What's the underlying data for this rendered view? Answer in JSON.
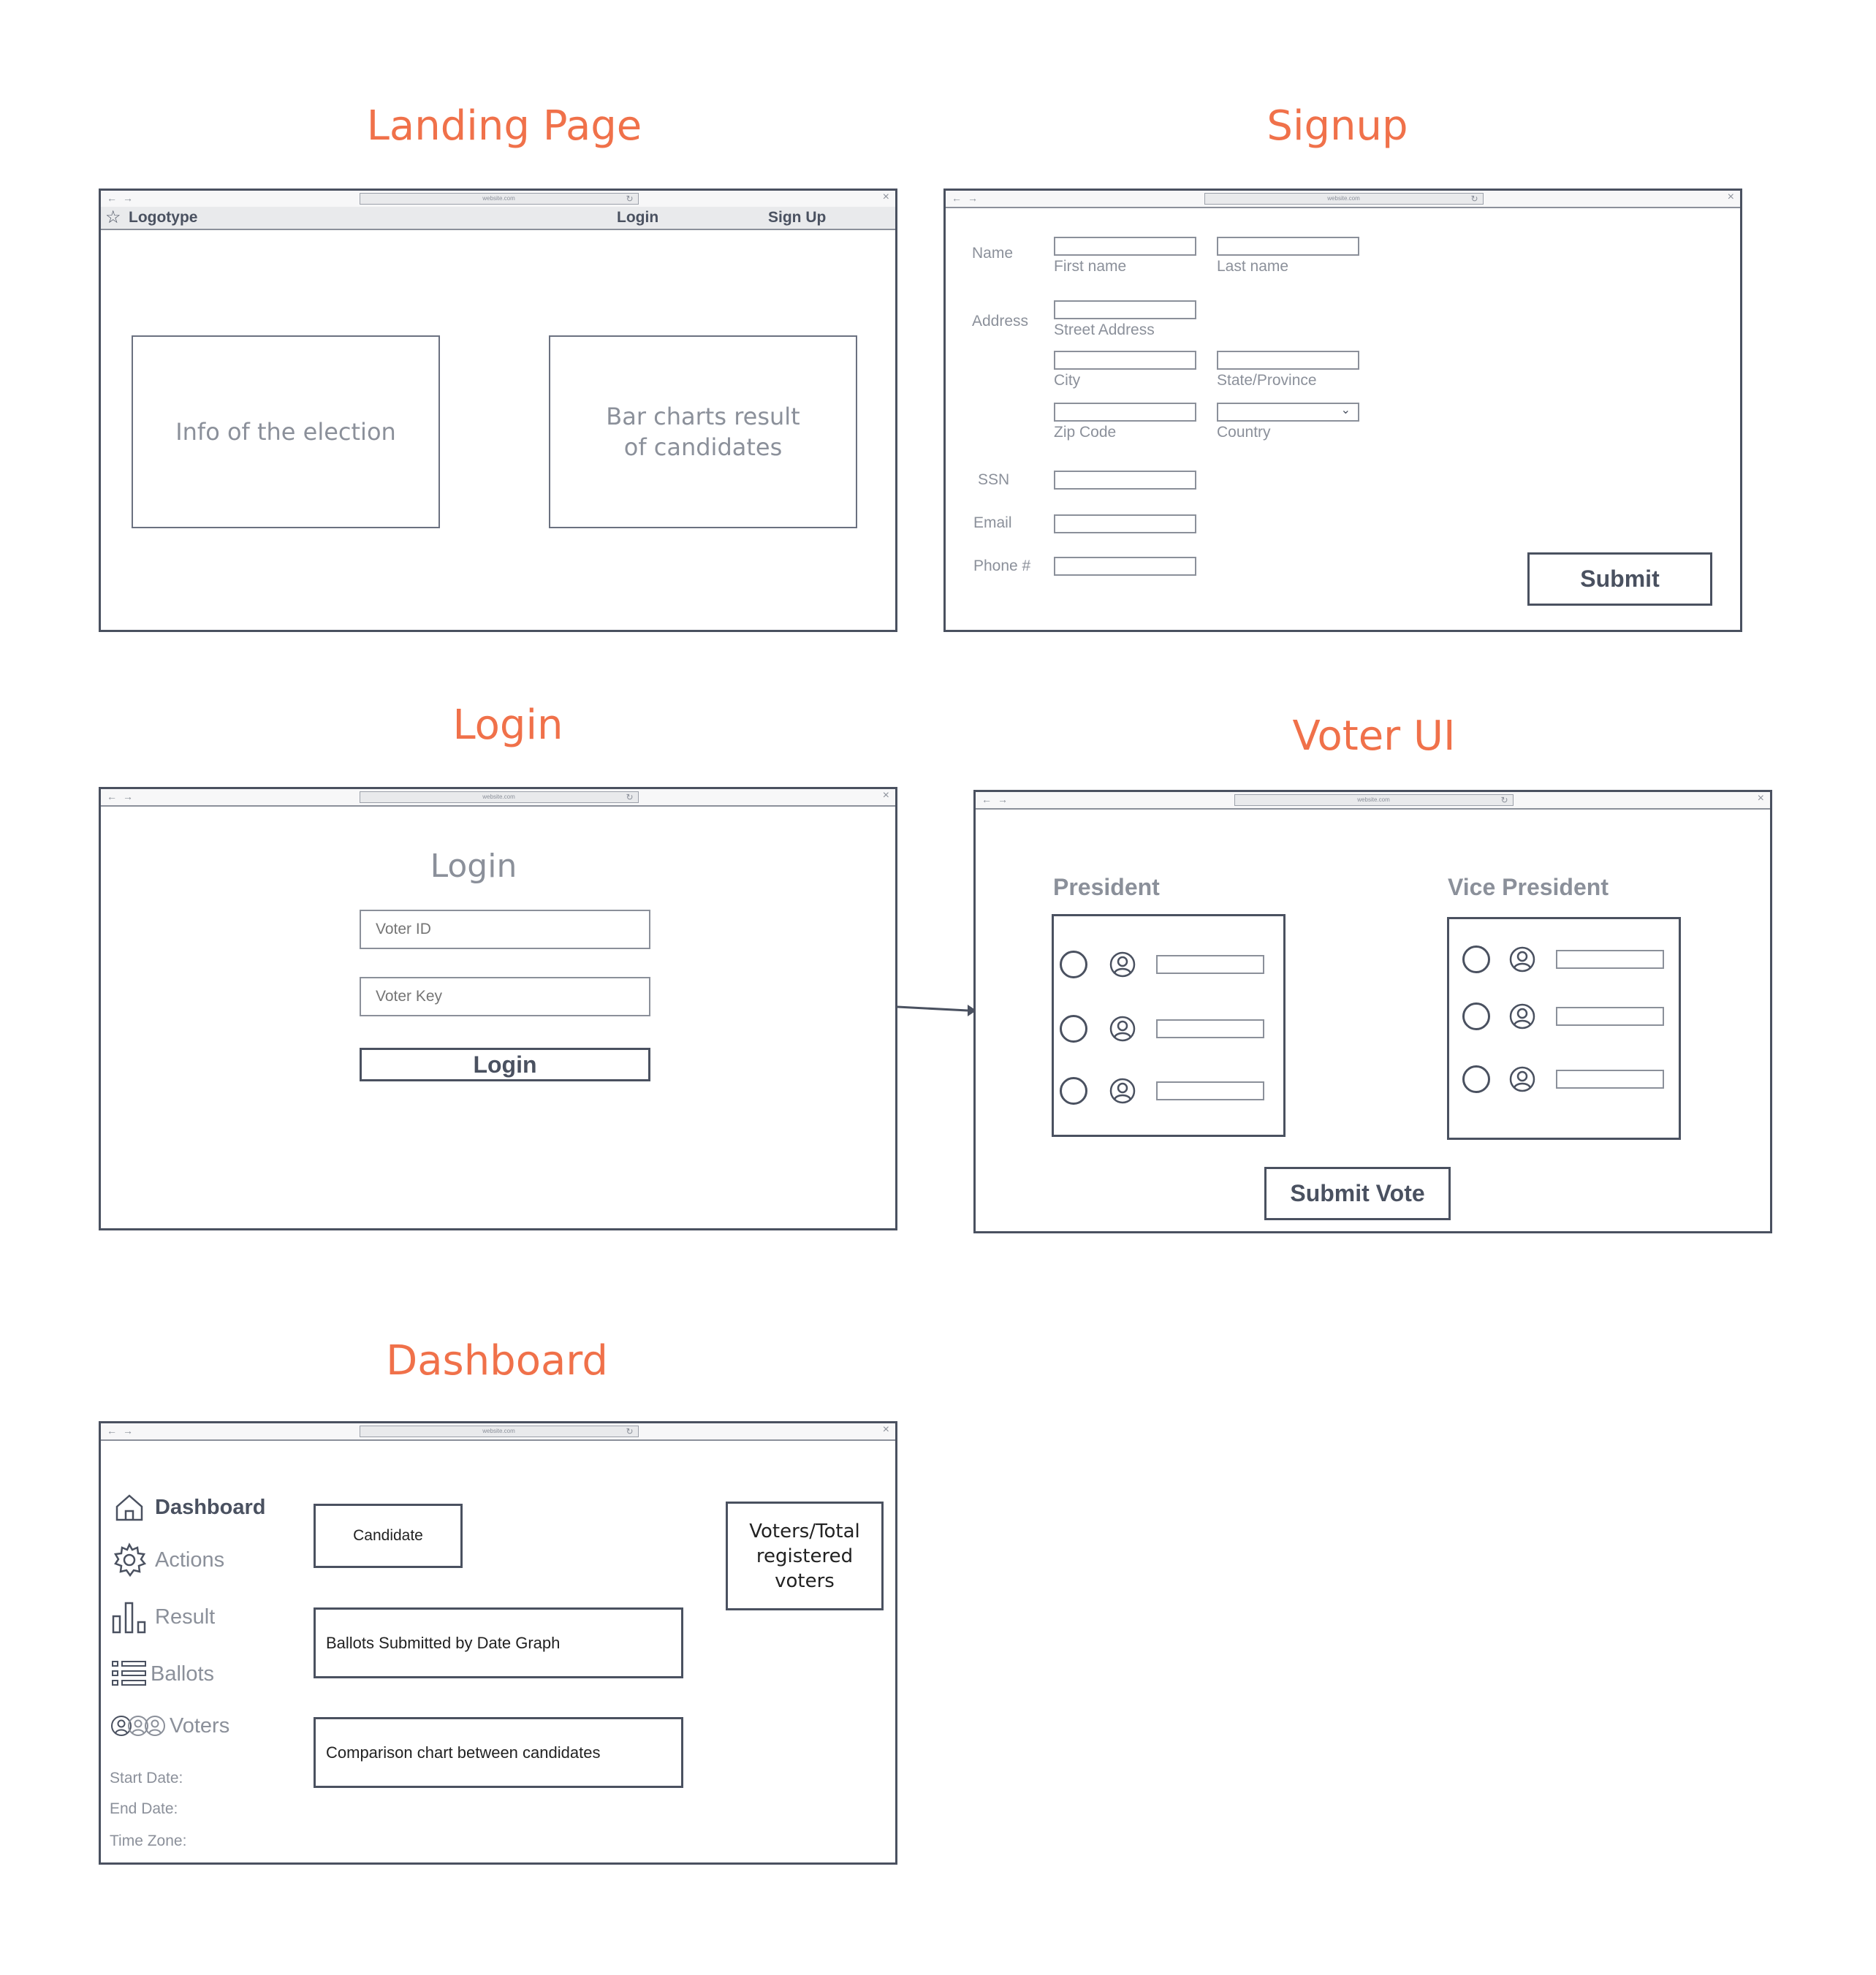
{
  "landing": {
    "title": "Landing Page",
    "url": "website.com",
    "logo": "Logotype",
    "nav_login": "Login",
    "nav_signup": "Sign Up",
    "info_box": "Info of the election",
    "chart_box": "Bar charts result of candidates",
    "logo_icon": "star-icon"
  },
  "signup": {
    "title": "Signup",
    "url": "website.com",
    "labels": {
      "name": "Name",
      "address": "Address",
      "ssn": "SSN",
      "email": "Email",
      "phone": "Phone #"
    },
    "hints": {
      "first_name": "First name",
      "last_name": "Last name",
      "street": "Street Address",
      "city": "City",
      "state": "State/Province",
      "zip": "Zip Code",
      "country": "Country"
    },
    "submit": "Submit"
  },
  "login": {
    "title": "Login",
    "url": "website.com",
    "heading": "Login",
    "voter_id_placeholder": "Voter ID",
    "voter_key_placeholder": "Voter Key",
    "button": "Login"
  },
  "voter": {
    "title": "Voter UI",
    "url": "website.com",
    "president": "President",
    "vice_president": "Vice President",
    "submit": "Submit Vote"
  },
  "dashboard": {
    "title": "Dashboard",
    "url": "website.com",
    "nav": {
      "dashboard": "Dashboard",
      "actions": "Actions",
      "result": "Result",
      "ballots": "Ballots",
      "voters": "Voters"
    },
    "meta": {
      "start_date": "Start Date:",
      "end_date": "End Date:",
      "time_zone": "Time Zone:"
    },
    "cards": {
      "candidate": "Candidate",
      "ballots_graph": "Ballots Submitted by Date Graph",
      "comparison": "Comparison chart between candidates",
      "voters_total": "Voters/Total registered voters"
    }
  },
  "icons": [
    "star-icon",
    "home-icon",
    "gear-icon",
    "bar-chart-icon",
    "list-icon",
    "users-icon",
    "user-avatar-icon",
    "reload-icon",
    "close-icon",
    "chevron-down-icon"
  ]
}
